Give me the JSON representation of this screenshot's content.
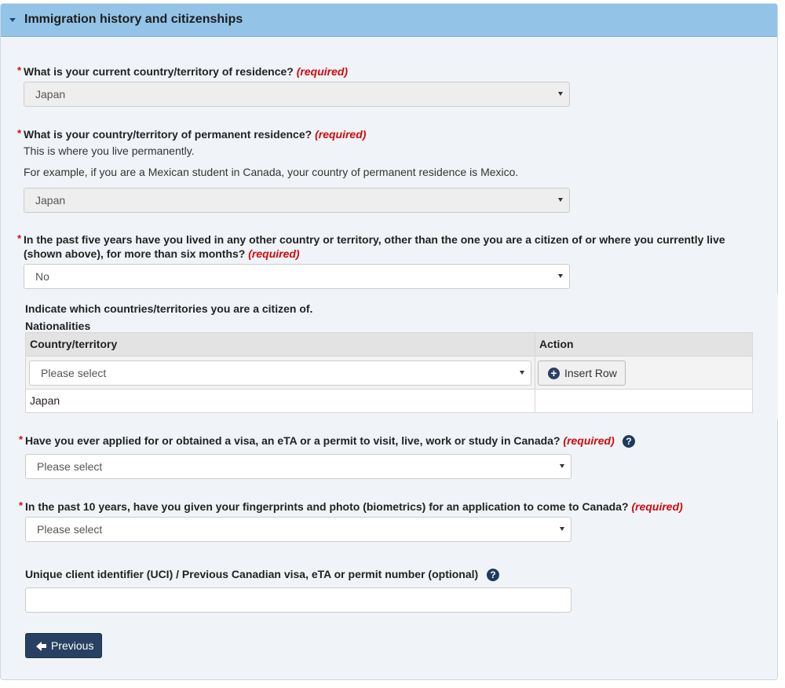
{
  "section": {
    "title": "Immigration history and citizenships"
  },
  "required_marker": "*",
  "required_text": "(required)",
  "q_current_residence": {
    "label": "What is your current country/territory of residence?",
    "value": "Japan"
  },
  "q_permanent_residence": {
    "label": "What is your country/territory of permanent residence?",
    "hint1": "This is where you live permanently.",
    "hint2": "For example, if you are a Mexican student in Canada, your country of permanent residence is Mexico.",
    "value": "Japan"
  },
  "q_lived_other": {
    "label_line1": "In the past five years have you lived in any other country or territory, other than the one you are a citizen of or where you currently live",
    "label_line2": "(shown above), for more than six months?",
    "value": "No"
  },
  "citizenship": {
    "intro": "Indicate which countries/territories you are a citizen of.",
    "table_caption": "Nationalities",
    "columns": [
      "Country/territory",
      "Action"
    ],
    "select_placeholder": "Please select",
    "insert_row_label": "Insert Row",
    "rows": [
      {
        "country": "Japan"
      }
    ]
  },
  "q_applied_visa": {
    "label": "Have you ever applied for or obtained a visa, an eTA or a permit to visit, live, work or study in Canada?",
    "value": "Please select"
  },
  "q_biometrics": {
    "label": "In the past 10 years, have you given your fingerprints and photo (biometrics) for an application to come to Canada?",
    "value": "Please select"
  },
  "q_uci": {
    "label": "Unique client identifier (UCI) / Previous Canadian visa, eTA or permit number (optional)",
    "value": ""
  },
  "help_glyph": "?",
  "buttons": {
    "previous": "Previous"
  },
  "colors": {
    "header_bg": "#93c4e8",
    "required_red": "#d3080c",
    "primary_button": "#284162",
    "panel_bg": "#f0f4f8"
  },
  "icons": [
    "caret-down-icon",
    "plus-circle-icon",
    "question-circle-icon",
    "arrow-left-icon"
  ]
}
